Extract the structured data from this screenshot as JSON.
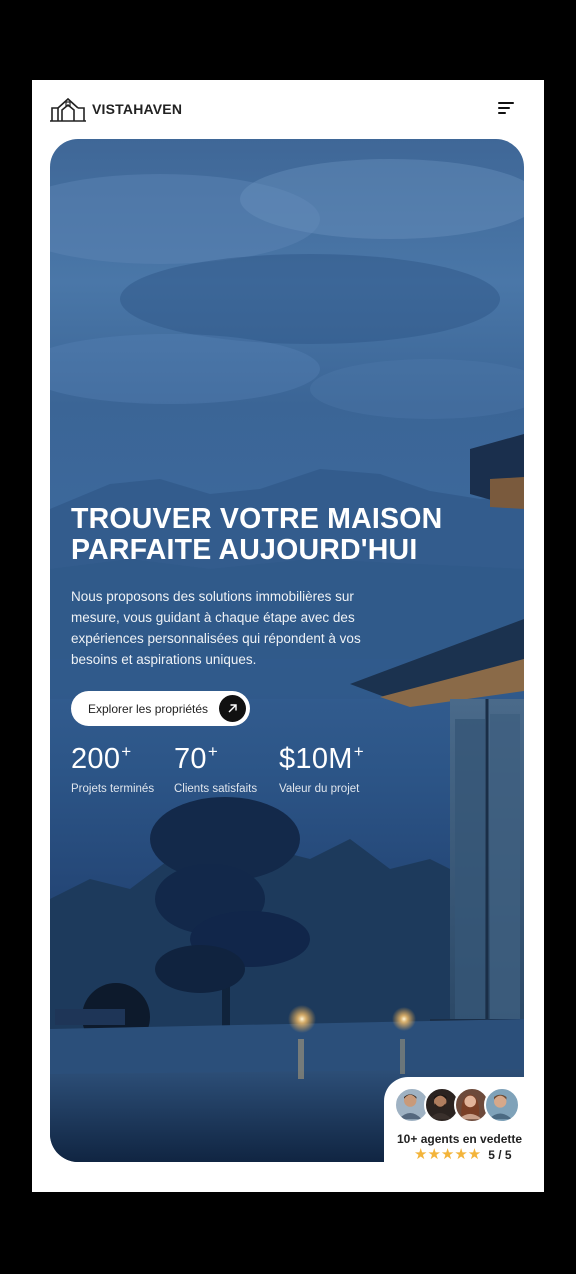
{
  "header": {
    "brand": "VISTAHAVEN",
    "logo_icon": "house-logo-icon",
    "menu_icon": "menu-icon"
  },
  "hero": {
    "title_line1": "TROUVER VOTRE MAISON",
    "title_line2": "PARFAITE AUJOURD'HUI",
    "description": "Nous proposons des solutions immobilières sur mesure, vous guidant à chaque étape avec des expériences personnalisées qui répondent à vos besoins et aspirations uniques.",
    "cta_label": "Explorer les propriétés",
    "cta_icon": "arrow-up-right-icon"
  },
  "stats": [
    {
      "value": "200",
      "suffix": "+",
      "label": "Projets terminés"
    },
    {
      "value": "70",
      "suffix": "+",
      "label": "Clients satisfaits"
    },
    {
      "value": "$10M",
      "suffix": "+",
      "label": "Valeur du projet"
    }
  ],
  "agents": {
    "title": "10+ agents en vedette",
    "stars": "★★★★★",
    "rating": "5 / 5"
  },
  "colors": {
    "accent_star": "#f3b43a",
    "hero_sky": "#4a77a8",
    "hero_dark": "#0f2241"
  }
}
